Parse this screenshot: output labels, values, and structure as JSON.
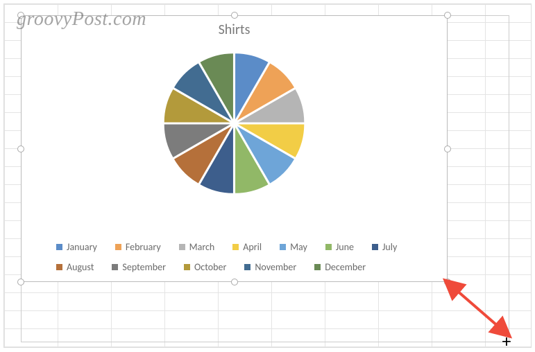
{
  "watermark": "groovyPost.com",
  "chart_data": {
    "type": "pie",
    "title": "Shirts",
    "categories": [
      "January",
      "February",
      "March",
      "April",
      "May",
      "June",
      "July",
      "August",
      "September",
      "October",
      "November",
      "December"
    ],
    "values": [
      8.3,
      8.3,
      8.3,
      8.3,
      8.3,
      8.3,
      8.3,
      8.3,
      8.3,
      8.3,
      8.3,
      8.3
    ],
    "colors": [
      "#5b8cc8",
      "#eea257",
      "#b5b5b5",
      "#f2cd46",
      "#6ea5d8",
      "#91b867",
      "#3d5e8c",
      "#b5703a",
      "#7c7c7c",
      "#b39a3b",
      "#426c91",
      "#6a8a55"
    ],
    "exploded": true,
    "legend_position": "bottom"
  },
  "legend_labels": {
    "0": "January",
    "1": "February",
    "2": "March",
    "3": "April",
    "4": "May",
    "5": "June",
    "6": "July",
    "7": "August",
    "8": "September",
    "9": "October",
    "10": "November",
    "11": "December"
  }
}
